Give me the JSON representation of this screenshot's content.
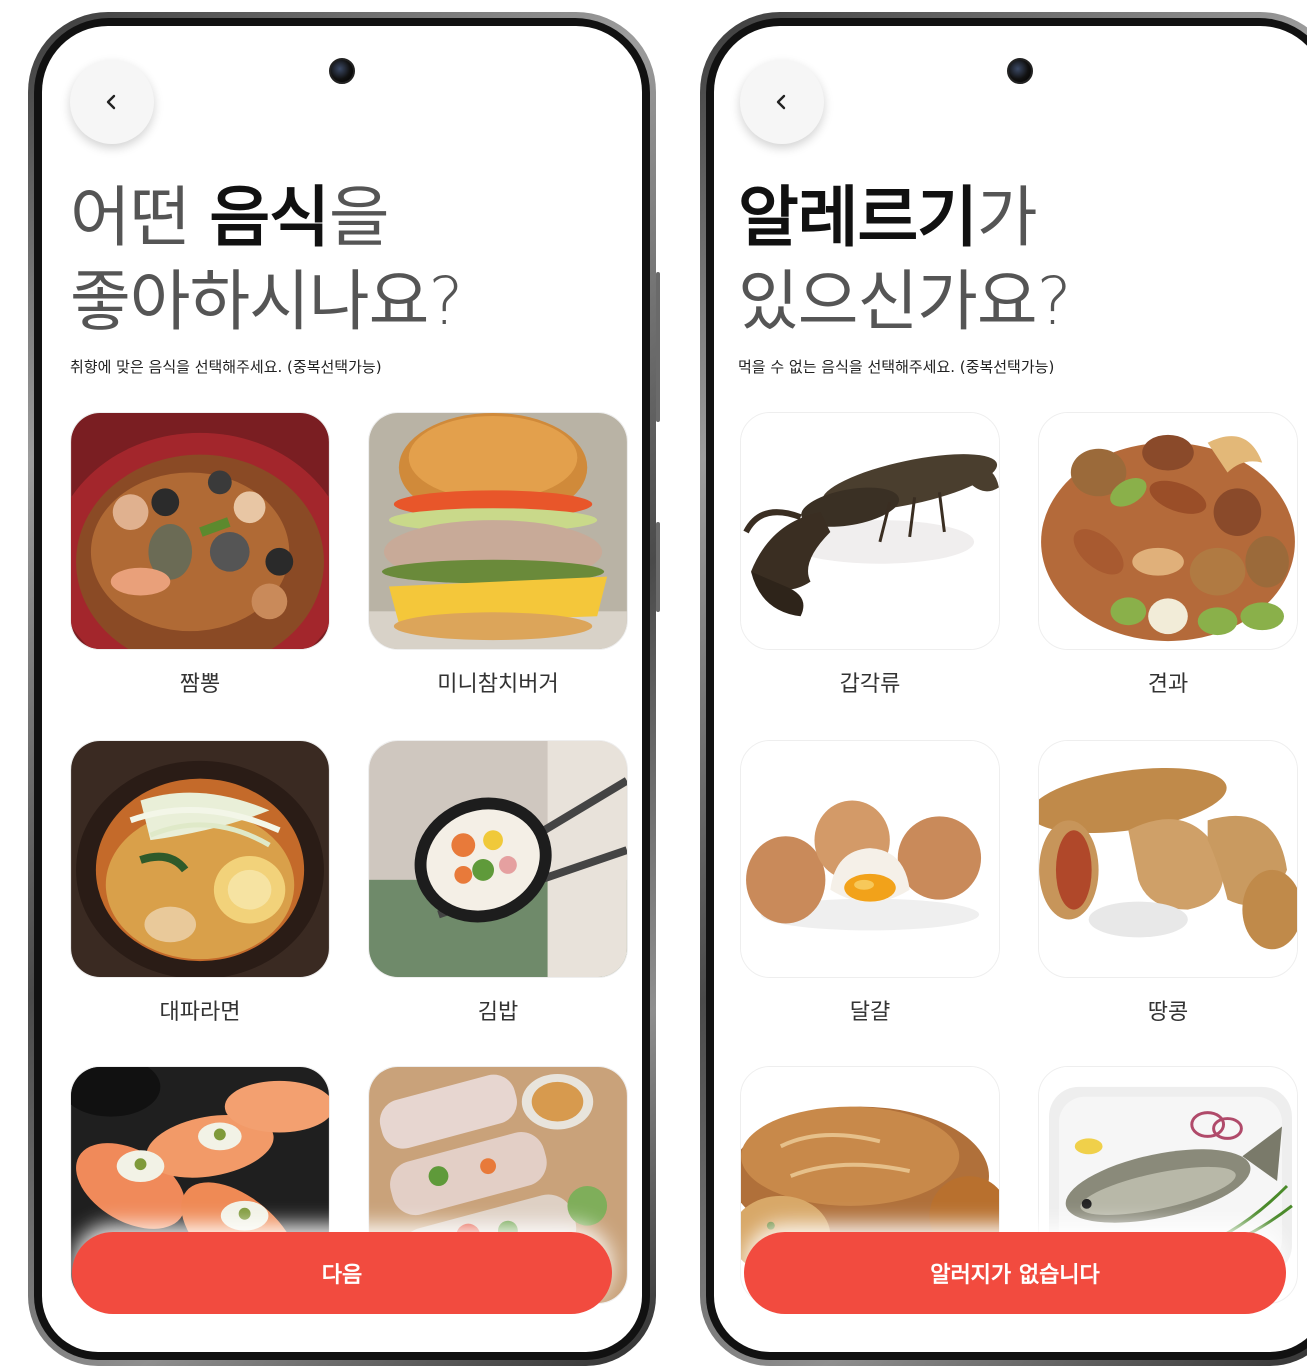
{
  "left": {
    "back_icon": "chevron-left-icon",
    "title_light_1": "어떤 ",
    "title_bold": "음식",
    "title_light_2": "을",
    "title_line2": "좋아하시나요?",
    "subtitle": "취향에 맞은 음식을 선택해주세요. (중복선택가능)",
    "items": [
      {
        "label": "짬뽕"
      },
      {
        "label": "미니참치버거"
      },
      {
        "label": "대파라면"
      },
      {
        "label": "김밥"
      },
      {
        "label": ""
      },
      {
        "label": ""
      }
    ],
    "cta": "다음"
  },
  "right": {
    "back_icon": "chevron-left-icon",
    "title_bold": "알레르기",
    "title_light": "가",
    "title_line2": "있으신가요?",
    "subtitle": "먹을 수 없는 음식을 선택해주세요. (중복선택가능)",
    "items": [
      {
        "label": "갑각류"
      },
      {
        "label": "견과"
      },
      {
        "label": "달걀"
      },
      {
        "label": "땅콩"
      },
      {
        "label": ""
      },
      {
        "label": ""
      }
    ],
    "cta": "알러지가 없습니다"
  },
  "colors": {
    "accent": "#f24b3f",
    "title_dark": "#111111",
    "title_light": "#555555"
  }
}
